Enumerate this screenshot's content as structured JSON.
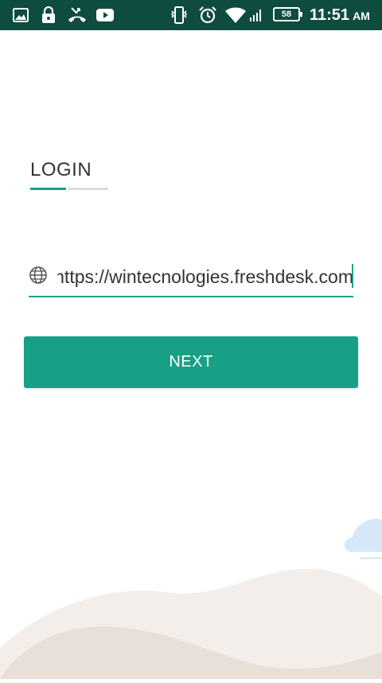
{
  "status_bar": {
    "battery_level": "58",
    "time": "11:51",
    "ampm": "AM",
    "icons": [
      "gallery-icon",
      "lock-icon",
      "missed-call-icon",
      "youtube-icon",
      "vibrate-icon",
      "alarm-icon",
      "wifi-icon",
      "signal-icon",
      "battery-icon"
    ]
  },
  "login": {
    "title": "LOGIN",
    "url_value": "https://wintecnologies.freshdesk.com",
    "next_label": "NEXT"
  },
  "colors": {
    "status_bar_bg": "#0f4c40",
    "accent": "#1ea085",
    "button_bg": "#17a085",
    "cloud": "#d6e8f8",
    "hills": "#ece6e0"
  }
}
